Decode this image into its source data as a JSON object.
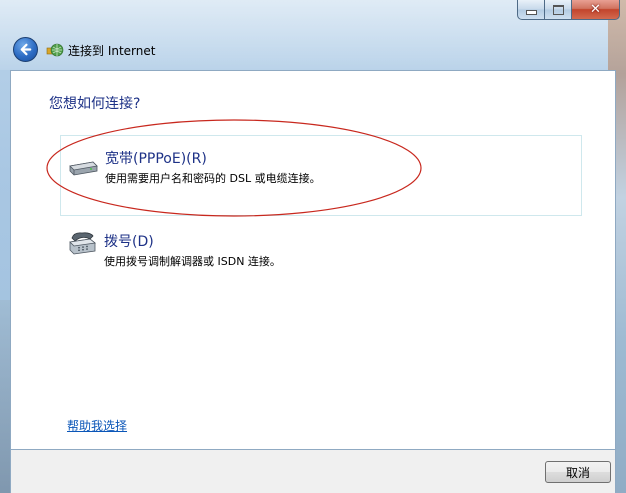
{
  "window": {
    "title": "连接到 Internet",
    "caption_buttons": {
      "minimize": "minimize-icon",
      "maximize": "maximize-icon",
      "close": "close-icon"
    }
  },
  "content": {
    "heading": "您想如何连接?",
    "options": [
      {
        "title": "宽带(PPPoE)(R)",
        "description": "使用需要用户名和密码的 DSL 或电缆连接。",
        "icon": "broadband-modem-icon",
        "selected": true
      },
      {
        "title": "拨号(D)",
        "description": "使用拨号调制解调器或 ISDN 连接。",
        "icon": "dialup-phone-icon",
        "selected": false
      }
    ],
    "help_link": "帮助我选择",
    "annotation_color": "#c8281e"
  },
  "footer": {
    "cancel_label": "取消"
  },
  "colors": {
    "heading": "#1e3287",
    "link": "#0b56b8",
    "selected_border": "#cfe8ed"
  }
}
